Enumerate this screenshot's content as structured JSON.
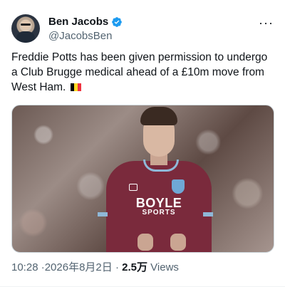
{
  "author": {
    "display_name": "Ben Jacobs",
    "handle": "@JacobsBen",
    "verified": true,
    "verified_color": "#1d9bf0"
  },
  "tweet": {
    "text": "Freddie Potts has been given permission to undergo a Club Brugge medical ahead of a £10m move from West Ham.",
    "flag": "belgium-flag-emoji"
  },
  "media": {
    "jersey_sponsor_line1": "BOYLE",
    "jersey_sponsor_line2": "SPORTS"
  },
  "meta": {
    "time": "10:28",
    "separator": "·",
    "date": "2026年8月2日",
    "views_count": "2.5万",
    "views_label": "Views"
  },
  "menu": {
    "more_label": "···"
  }
}
